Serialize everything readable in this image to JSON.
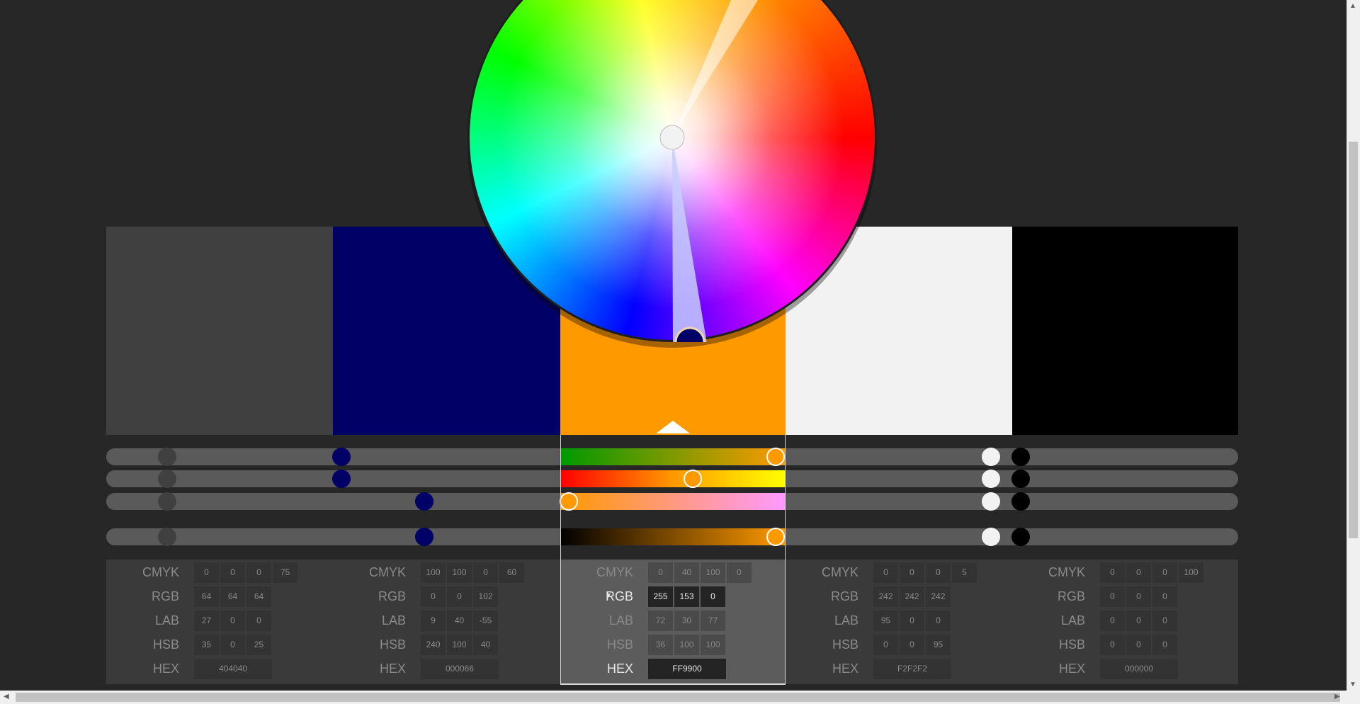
{
  "colors": {
    "swatches": [
      "#404040",
      "#000066",
      "#FF9900",
      "#F2F2F2",
      "#000000"
    ],
    "active_index": 2
  },
  "columns": [
    {
      "cmyk": [
        "0",
        "0",
        "0",
        "75"
      ],
      "rgb": [
        "64",
        "64",
        "64"
      ],
      "lab": [
        "27",
        "0",
        "0"
      ],
      "hsb": [
        "35",
        "0",
        "25"
      ],
      "hex": "404040"
    },
    {
      "cmyk": [
        "100",
        "100",
        "0",
        "60"
      ],
      "rgb": [
        "0",
        "0",
        "102"
      ],
      "lab": [
        "9",
        "40",
        "-55"
      ],
      "hsb": [
        "240",
        "100",
        "40"
      ],
      "hex": "000066"
    },
    {
      "cmyk": [
        "0",
        "40",
        "100",
        "0"
      ],
      "rgb": [
        "255",
        "153",
        "0"
      ],
      "lab": [
        "72",
        "30",
        "77"
      ],
      "hsb": [
        "36",
        "100",
        "100"
      ],
      "hex": "FF9900"
    },
    {
      "cmyk": [
        "0",
        "0",
        "0",
        "5"
      ],
      "rgb": [
        "242",
        "242",
        "242"
      ],
      "lab": [
        "95",
        "0",
        "0"
      ],
      "hsb": [
        "0",
        "0",
        "95"
      ],
      "hex": "F2F2F2"
    },
    {
      "cmyk": [
        "0",
        "0",
        "0",
        "100"
      ],
      "rgb": [
        "0",
        "0",
        "0"
      ],
      "lab": [
        "0",
        "0",
        "0"
      ],
      "hsb": [
        "0",
        "0",
        "0"
      ],
      "hex": "000000"
    }
  ],
  "labels": {
    "cmyk": "CMYK",
    "rgb": "RGB",
    "lab": "LAB",
    "hsb": "HSB",
    "hex": "HEX"
  },
  "active_mode": "rgb",
  "mode_dropdown_icon": "triangle-down-icon"
}
